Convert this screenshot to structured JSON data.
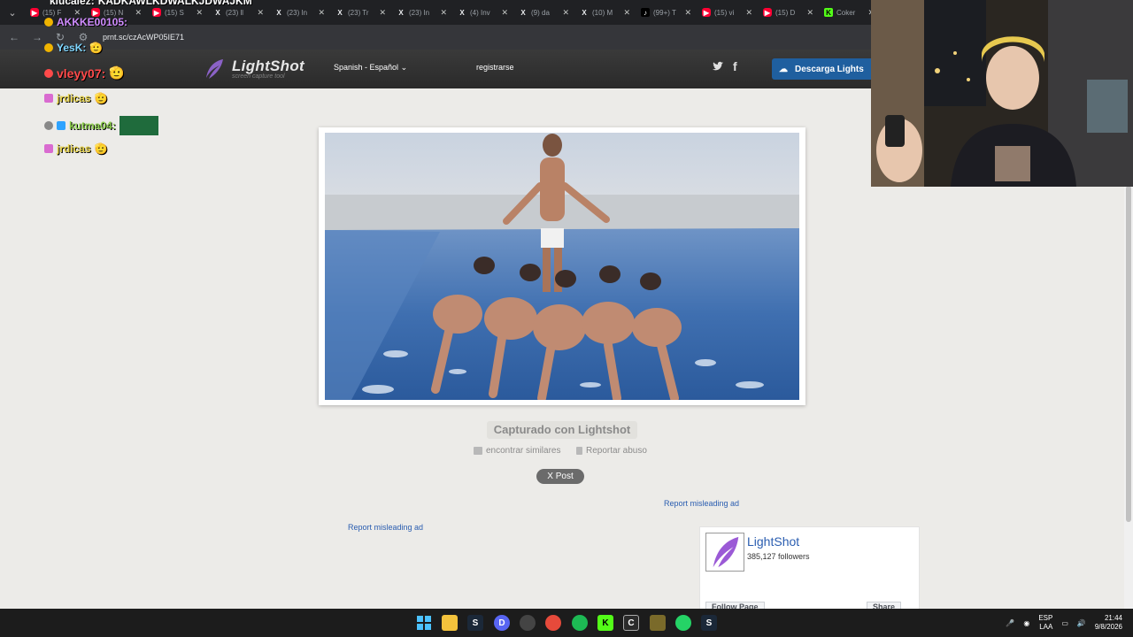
{
  "browser": {
    "tabs": [
      {
        "icon": "youtube-icon",
        "title": "(15) F"
      },
      {
        "icon": "youtube-icon",
        "title": "(15) N"
      },
      {
        "icon": "youtube-icon",
        "title": "(15) S"
      },
      {
        "icon": "x-icon",
        "title": "(23) ll"
      },
      {
        "icon": "x-icon",
        "title": "(23) In"
      },
      {
        "icon": "x-icon",
        "title": "(23) Tr"
      },
      {
        "icon": "x-icon",
        "title": "(23) In"
      },
      {
        "icon": "x-icon",
        "title": "(4) Inv"
      },
      {
        "icon": "x-icon",
        "title": "(9) da"
      },
      {
        "icon": "x-icon",
        "title": "(10) M"
      },
      {
        "icon": "tiktok-icon",
        "title": "(99+) T"
      },
      {
        "icon": "youtube-icon",
        "title": "(15) vi"
      },
      {
        "icon": "youtube-icon",
        "title": "(15) D"
      },
      {
        "icon": "kick-icon",
        "title": "Coker"
      }
    ],
    "url": "prnt.sc/czAcWP05IE71"
  },
  "lightshot": {
    "logo_name": "LightShot",
    "logo_tagline": "screen capture tool",
    "language": "Spanish - Español",
    "register": "registrarse",
    "download_label": "Descarga Lights",
    "captured_label": "Capturado con Lightshot",
    "find_similar": "encontrar similares",
    "report_abuse": "Reportar abuso",
    "x_post": "X  Post",
    "report_ad_1": "Report misleading ad",
    "report_ad_2": "Report misleading ad",
    "fb_widget": {
      "page_name": "LightShot",
      "followers": "385,127 followers",
      "follow_label": "Follow Page",
      "share_label": "Share"
    }
  },
  "chat": [
    {
      "user": "kiucalez:",
      "text": "KADKAWLKDWALKJDWAJKM",
      "color": "#ffffff"
    },
    {
      "user": "AKKKE00105:",
      "text": "",
      "color": "#d08cff"
    },
    {
      "user": "YesK:",
      "text": "",
      "color": "#7fd6ff"
    },
    {
      "user": "vleyy07:",
      "text": "",
      "color": "#ff4a4a"
    },
    {
      "user": "jrdicas",
      "text": "",
      "color": "#e6d24a"
    },
    {
      "user": "kutma04:",
      "text": "",
      "color": "#8fd14f"
    },
    {
      "user": "jrdicas",
      "text": "",
      "color": "#e6d24a"
    }
  ],
  "taskbar": {
    "lang_top": "ESP",
    "lang_bottom": "LAA",
    "time": "21:44",
    "date": "9/8/2026"
  }
}
